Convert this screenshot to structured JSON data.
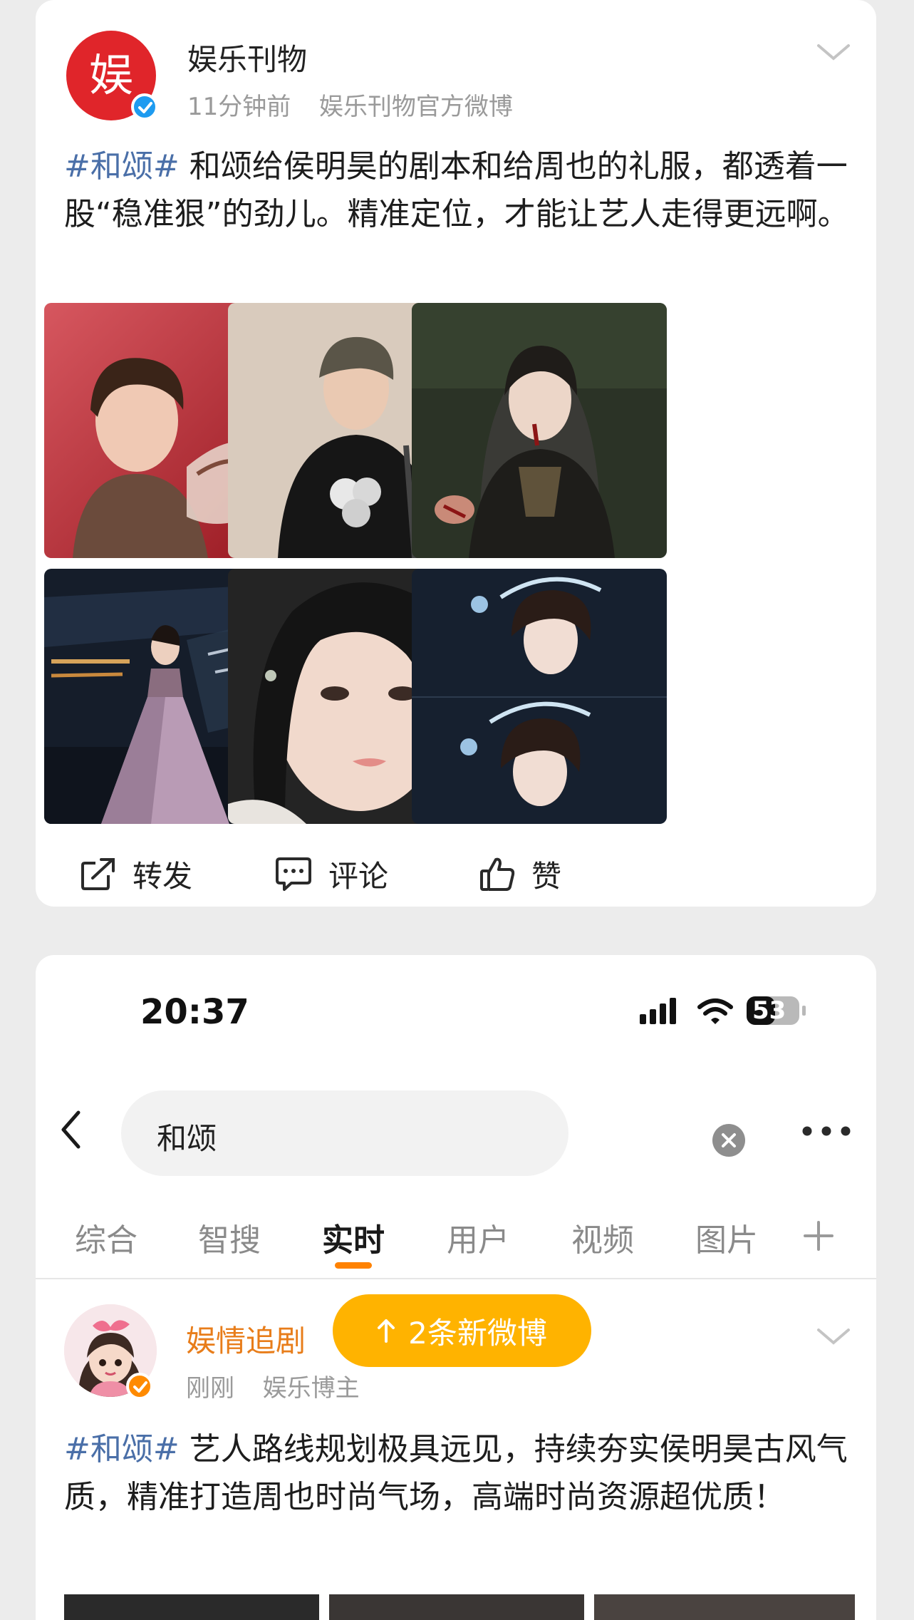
{
  "post": {
    "account_name": "娱乐刊物",
    "avatar_glyph": "娱",
    "time": "11分钟前",
    "source": "娱乐刊物官方微博",
    "hashtag": "#和颂#",
    "body": " 和颂给侯明昊的剧本和给周也的礼服，都透着一股“稳准狠”的劲儿。精准定位，才能让艺人走得更远啊。",
    "images": [
      {
        "icon": "photo-man-red-background"
      },
      {
        "icon": "photo-man-beanie"
      },
      {
        "icon": "photo-costume-drama-man"
      },
      {
        "icon": "photo-woman-gown-stage"
      },
      {
        "icon": "photo-woman-closeup"
      },
      {
        "icon": "photo-woman-headpiece"
      }
    ],
    "actions": {
      "repost": "转发",
      "comment": "评论",
      "like": "赞"
    }
  },
  "phone": {
    "status_time": "20:37",
    "battery": "53",
    "search_value": "和颂",
    "tabs": [
      {
        "label": "综合"
      },
      {
        "label": "智搜"
      },
      {
        "label": "实时"
      },
      {
        "label": "用户"
      },
      {
        "label": "视频"
      },
      {
        "label": "图片"
      }
    ],
    "active_tab": "实时",
    "new_posts_label": "2条新微博",
    "feed_item": {
      "account_name": "娱情追剧",
      "time": "刚刚",
      "source": "娱乐博主",
      "hashtag": "#和颂#",
      "body": " 艺人路线规划极具远见，持续夯实侯明昊古风气质，精准打造周也时尚气场，高端时尚资源超优质！"
    }
  },
  "colors": {
    "accent": "#ff8200",
    "hashtag": "#4a6fa8",
    "verified_blue": "#1e9bf0",
    "verified_orange": "#ff8a00",
    "new_posts_pill": "#ffb300"
  }
}
